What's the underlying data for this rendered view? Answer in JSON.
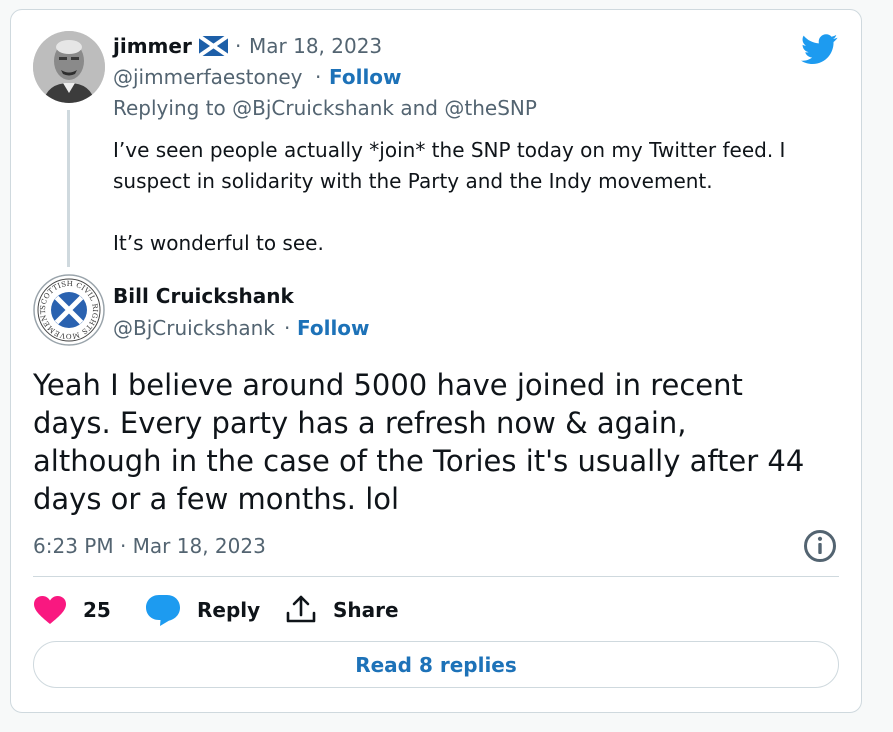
{
  "parent_tweet": {
    "author_name": "jimmer",
    "flag_icon": "scotland-flag-icon",
    "separator": "·",
    "date": "Mar 18, 2023",
    "handle": "@jimmerfaestoney",
    "follow_label": "Follow",
    "replying_to_prefix": "Replying to",
    "replying_to_user1": "@BjCruickshank",
    "replying_to_and": "and",
    "replying_to_user2": "@theSNP",
    "text_p1": "I’ve seen people actually *join* the SNP today on my Twitter feed. I suspect in solidarity with the Party and the Indy movement.",
    "text_p2": "It’s wonderful to see."
  },
  "main_tweet": {
    "author_name": "Bill Cruickshank",
    "handle": "@BjCruickshank",
    "separator": "·",
    "follow_label": "Follow",
    "avatar_text": "SCOTTISH CIVIL RIGHTS MOVEMENT",
    "text": "Yeah I believe around 5000 have joined in recent days. Every party has a refresh now & again, although in the case of the Tories it's usually after 44 days or a few months. lol",
    "timestamp": "6:23 PM · Mar 18, 2023"
  },
  "actions": {
    "like_count": "25",
    "reply_label": "Reply",
    "share_label": "Share"
  },
  "read_replies_label": "Read 8 replies",
  "colors": {
    "link_blue": "#1d72b8",
    "twitter_blue": "#1d9bf0",
    "like_pink": "#f91880",
    "muted": "#536471",
    "border": "#cfd9de"
  }
}
